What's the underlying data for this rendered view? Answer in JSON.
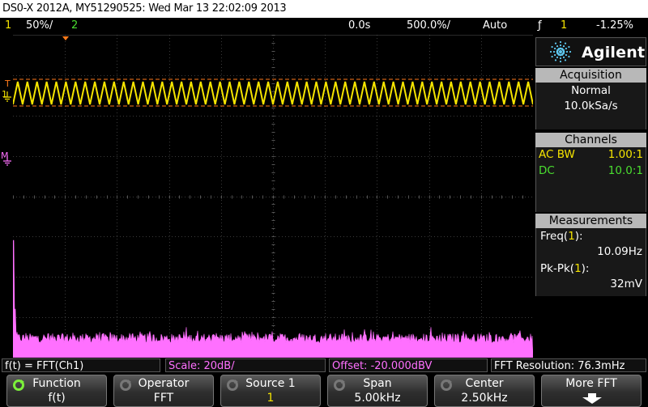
{
  "title": "DS0-X 2012A, MY51290525: Wed Mar 13 22:02:09 2013",
  "status": {
    "ch1_num": "1",
    "ch1_scale": "50%/",
    "ch2_num": "2",
    "time_offset": "0.0s",
    "time_scale": "500.0%/",
    "trigger_mode": "Auto",
    "trigger_symbol": "ƒ",
    "trigger_src": "1",
    "trigger_level": "-1.25%"
  },
  "markers": {
    "trigger_level": "T",
    "ch1": "1",
    "math": "M"
  },
  "panel": {
    "logo": "Agilent",
    "acquisition": {
      "header": "Acquisition",
      "mode": "Normal",
      "rate": "10.0kSa/s"
    },
    "channels": {
      "header": "Channels",
      "rows": [
        {
          "label": "AC BW",
          "value": "1.00:1",
          "color": "#f5e400"
        },
        {
          "label": "DC",
          "value": "10.0:1",
          "color": "#4ade30"
        }
      ]
    },
    "measurements": {
      "header": "Measurements",
      "items": [
        {
          "label_prefix": "Freq(",
          "label_ch": "1",
          "label_suffix": "):",
          "value": "10.09Hz"
        },
        {
          "label_prefix": "Pk-Pk(",
          "label_ch": "1",
          "label_suffix": "):",
          "value": "32mV"
        }
      ]
    }
  },
  "info": {
    "function": "f(t) = FFT(Ch1)",
    "scale": "Scale: 20dB/",
    "offset": "Offset: -20.000dBV",
    "resolution": "FFT Resolution: 76.3mHz"
  },
  "softkeys": [
    {
      "label": "Function",
      "value": "f(t)",
      "icon": "rotate-knob-icon"
    },
    {
      "label": "Operator",
      "value": "FFT",
      "icon": "rotate-knob-icon"
    },
    {
      "label": "Source 1",
      "value": "1",
      "icon": "rotate-knob-icon"
    },
    {
      "label": "Span",
      "value": "5.00kHz",
      "icon": "rotate-knob-icon"
    },
    {
      "label": "Center",
      "value": "2.50kHz",
      "icon": "rotate-knob-icon"
    },
    {
      "label": "More FFT",
      "value": "",
      "icon": "arrow-down-icon"
    }
  ],
  "colors": {
    "ch1": "#f5e400",
    "ch2": "#4ade30",
    "math": "#ff70ff",
    "trigger": "#ff7a1a",
    "grid": "#3a3a3a"
  }
}
